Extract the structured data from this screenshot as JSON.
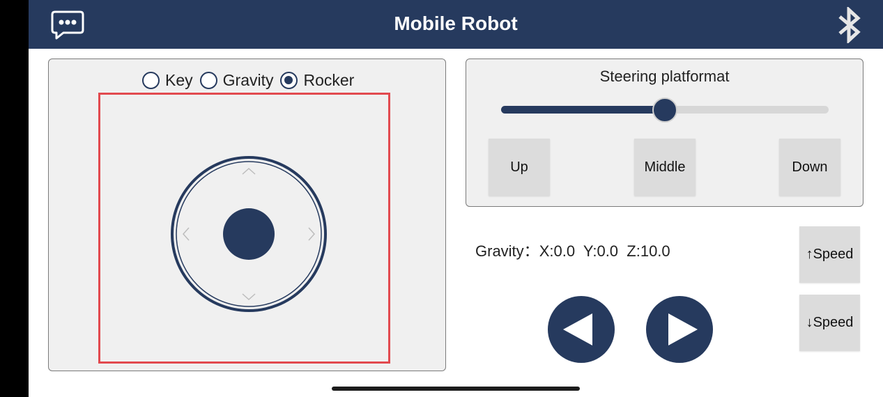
{
  "header": {
    "title": "Mobile Robot",
    "chat_icon": "chat-bubble-icon",
    "bluetooth_icon": "bluetooth-icon"
  },
  "mode": {
    "options": [
      {
        "label": "Key",
        "selected": false
      },
      {
        "label": "Gravity",
        "selected": false
      },
      {
        "label": "Rocker",
        "selected": true
      }
    ]
  },
  "steering": {
    "title": "Steering platformat",
    "slider_value": 0.5,
    "buttons": {
      "up": "Up",
      "middle": "Middle",
      "down": "Down"
    }
  },
  "gravity": {
    "label": "Gravity：",
    "x": "X:0.0",
    "y": "Y:0.0",
    "z": "Z:10.0"
  },
  "speed": {
    "up_label": "↑Speed",
    "down_label": "↓Speed"
  },
  "colors": {
    "primary": "#263a5e",
    "highlight": "#e24a4f",
    "panel_bg": "#f0f0f0",
    "button_bg": "#dcdcdc"
  }
}
